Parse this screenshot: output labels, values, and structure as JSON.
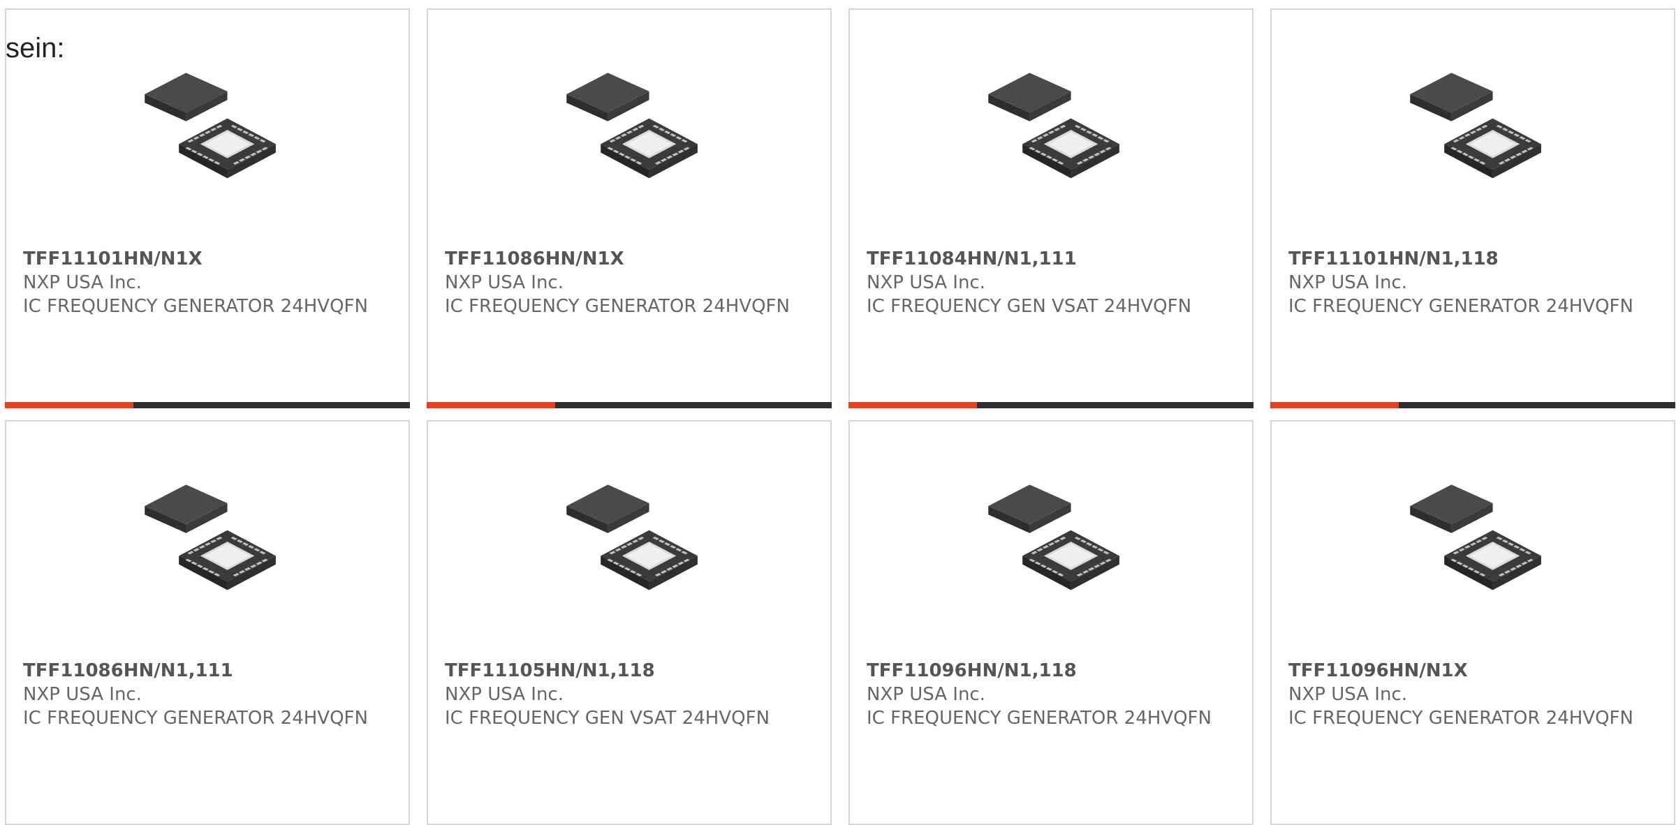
{
  "lead_text": "sein:",
  "accent_color": "#e8401c",
  "bar_color": "#2f2f2f",
  "products": [
    {
      "part_number": "TFF11101HN/N1X",
      "manufacturer": "NXP USA Inc.",
      "description": "IC FREQUENCY GENERATOR 24HVQFN",
      "image_icon": "qfn-chip-icon"
    },
    {
      "part_number": "TFF11086HN/N1X",
      "manufacturer": "NXP USA Inc.",
      "description": "IC FREQUENCY GENERATOR 24HVQFN",
      "image_icon": "qfn-chip-icon"
    },
    {
      "part_number": "TFF11084HN/N1,111",
      "manufacturer": "NXP USA Inc.",
      "description": "IC FREQUENCY GEN VSAT 24HVQFN",
      "image_icon": "qfn-chip-icon"
    },
    {
      "part_number": "TFF11101HN/N1,118",
      "manufacturer": "NXP USA Inc.",
      "description": "IC FREQUENCY GENERATOR 24HVQFN",
      "image_icon": "qfn-chip-icon"
    },
    {
      "part_number": "TFF11086HN/N1,111",
      "manufacturer": "NXP USA Inc.",
      "description": "IC FREQUENCY GENERATOR 24HVQFN",
      "image_icon": "qfn-chip-icon"
    },
    {
      "part_number": "TFF11105HN/N1,118",
      "manufacturer": "NXP USA Inc.",
      "description": "IC FREQUENCY GEN VSAT 24HVQFN",
      "image_icon": "qfn-chip-icon"
    },
    {
      "part_number": "TFF11096HN/N1,118",
      "manufacturer": "NXP USA Inc.",
      "description": "IC FREQUENCY GENERATOR 24HVQFN",
      "image_icon": "qfn-chip-icon"
    },
    {
      "part_number": "TFF11096HN/N1X",
      "manufacturer": "NXP USA Inc.",
      "description": "IC FREQUENCY GENERATOR 24HVQFN",
      "image_icon": "qfn-chip-icon"
    }
  ]
}
